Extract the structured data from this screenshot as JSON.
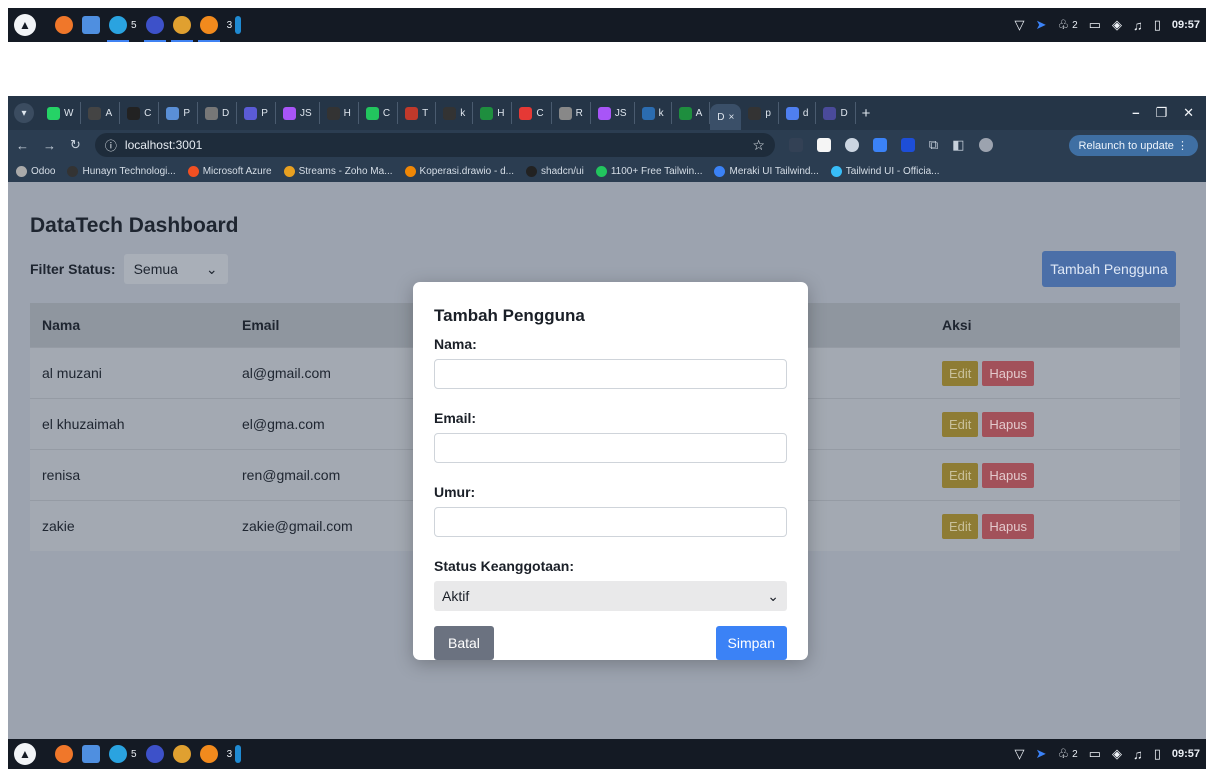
{
  "taskbar": {
    "launcher_glyph": "▲",
    "apps": [
      {
        "name": "firefox-icon",
        "color": "#f0772a"
      },
      {
        "name": "files-icon",
        "color": "#4f8fe0"
      },
      {
        "name": "telegram-icon",
        "color": "#2aa3e0"
      },
      {
        "name": "circle-app-icon",
        "color": "#3d51c9"
      },
      {
        "name": "chrome-icon",
        "color": "#e0a030"
      },
      {
        "name": "pencil-app-icon",
        "color": "#f28a1d"
      },
      {
        "name": "vscode-icon",
        "color": "#1f8ad2"
      }
    ],
    "telegram_count": "5",
    "vscode_count": "3",
    "tray_count": "2",
    "time": "09:57"
  },
  "browser": {
    "tabs": [
      {
        "label": "W",
        "color": "#25d366"
      },
      {
        "label": "A",
        "color": "#444"
      },
      {
        "label": "C",
        "color": "#222"
      },
      {
        "label": "P",
        "color": "#5a8fd6"
      },
      {
        "label": "D",
        "color": "#777"
      },
      {
        "label": "P",
        "color": "#5b5bd6"
      },
      {
        "label": "JS",
        "color": "#a855f7"
      },
      {
        "label": "H",
        "color": "#333"
      },
      {
        "label": "C",
        "color": "#22c55e"
      },
      {
        "label": "T",
        "color": "#c0392b"
      },
      {
        "label": "k",
        "color": "#333"
      },
      {
        "label": "H",
        "color": "#1e8e3e"
      },
      {
        "label": "C",
        "color": "#e53935"
      },
      {
        "label": "R",
        "color": "#888"
      },
      {
        "label": "JS",
        "color": "#a855f7"
      },
      {
        "label": "k",
        "color": "#2b6cb0"
      },
      {
        "label": "A",
        "color": "#1e8e3e"
      }
    ],
    "active_tab": {
      "label": "D",
      "close": "×"
    },
    "tabs_after": [
      {
        "label": "p",
        "color": "#333"
      },
      {
        "label": "d",
        "color": "#4f7ff0"
      },
      {
        "label": "D",
        "color": "#4a4a9a"
      }
    ],
    "new_tab": "+",
    "url": "localhost:3001",
    "relaunch_label": "Relaunch to update",
    "bookmarks": [
      {
        "label": "Odoo",
        "color": "#aaa"
      },
      {
        "label": "Hunayn Technologi...",
        "color": "#333"
      },
      {
        "label": "Microsoft Azure",
        "color": "#f25022"
      },
      {
        "label": "Streams - Zoho Ma...",
        "color": "#e8a020"
      },
      {
        "label": "Koperasi.drawio - d...",
        "color": "#f08705"
      },
      {
        "label": "shadcn/ui",
        "color": "#222"
      },
      {
        "label": "1100+ Free Tailwin...",
        "color": "#22c55e"
      },
      {
        "label": "Meraki UI Tailwind...",
        "color": "#3b82f6"
      },
      {
        "label": "Tailwind UI - Officia...",
        "color": "#38bdf8"
      }
    ]
  },
  "page": {
    "title": "DataTech Dashboard",
    "filter_label": "Filter Status:",
    "filter_value": "Semua",
    "add_button": "Tambah Pengguna",
    "columns": {
      "name": "Nama",
      "email": "Email",
      "action": "Aksi"
    },
    "rows": [
      {
        "name": "al muzani",
        "email": "al@gmail.com"
      },
      {
        "name": "el khuzaimah",
        "email": "el@gma.com"
      },
      {
        "name": "renisa",
        "email": "ren@gmail.com"
      },
      {
        "name": "zakie",
        "email": "zakie@gmail.com"
      }
    ],
    "edit_label": "Edit",
    "delete_label": "Hapus"
  },
  "modal": {
    "title": "Tambah Pengguna",
    "name_label": "Nama:",
    "name_value": "",
    "email_label": "Email:",
    "email_value": "",
    "age_label": "Umur:",
    "age_value": "",
    "status_label": "Status Keanggotaan:",
    "status_value": "Aktif",
    "cancel_label": "Batal",
    "save_label": "Simpan"
  }
}
